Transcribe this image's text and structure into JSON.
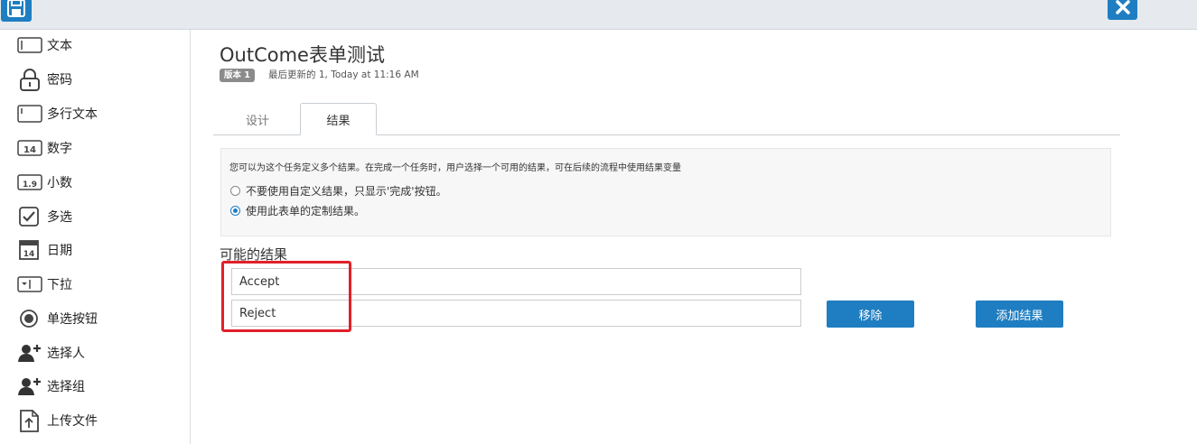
{
  "header": {
    "save_icon": "floppy-disk-icon",
    "close_icon": "close-icon",
    "accent_color": "#1f7ec1"
  },
  "sidebar": {
    "items": [
      {
        "label": "文本",
        "icon": "text-field-icon"
      },
      {
        "label": "密码",
        "icon": "lock-icon"
      },
      {
        "label": "多行文本",
        "icon": "textarea-icon"
      },
      {
        "label": "数字",
        "icon": "number-icon"
      },
      {
        "label": "小数",
        "icon": "decimal-icon"
      },
      {
        "label": "多选",
        "icon": "checkbox-icon"
      },
      {
        "label": "日期",
        "icon": "calendar-icon"
      },
      {
        "label": "下拉",
        "icon": "dropdown-icon"
      },
      {
        "label": "单选按钮",
        "icon": "radio-icon"
      },
      {
        "label": "选择人",
        "icon": "add-person-icon"
      },
      {
        "label": "选择组",
        "icon": "add-group-icon"
      },
      {
        "label": "上传文件",
        "icon": "upload-file-icon"
      }
    ]
  },
  "main": {
    "title": "OutCome表单测试",
    "version_badge": "版本 1",
    "last_updated": "最后更新的 1, Today at 11:16 AM",
    "tabs": [
      {
        "label": "设计",
        "active": false
      },
      {
        "label": "结果",
        "active": true
      }
    ],
    "info": {
      "description": "您可以为这个任务定义多个结果。在完成一个任务时，用户选择一个可用的结果，可在后续的流程中使用结果变量",
      "options": [
        {
          "label": "不要使用自定义结果，只显示'完成'按钮。",
          "checked": false
        },
        {
          "label": "使用此表单的定制结果。",
          "checked": true
        }
      ]
    },
    "results_heading": "可能的结果",
    "results": [
      "Accept",
      "Reject"
    ],
    "remove_button": "移除",
    "add_button": "添加结果",
    "highlight_color": "#e0202a"
  }
}
